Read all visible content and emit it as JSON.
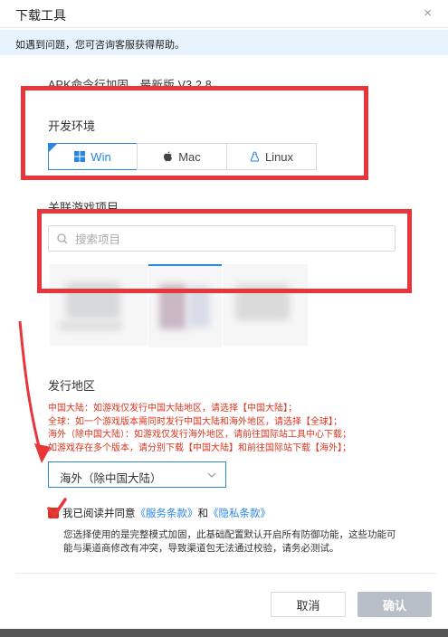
{
  "dialog": {
    "title": "下载工具",
    "close_glyph": "×",
    "notice": "如遇到问题，您可咨询客服获得帮助。",
    "product_line": "APK命令行加固　最新版 V3.2.8"
  },
  "env": {
    "label": "开发环境",
    "options": [
      "Win",
      "Mac",
      "Linux"
    ],
    "selected": "Win"
  },
  "projects": {
    "label": "关联游戏项目",
    "search_placeholder": "搜索项目"
  },
  "region": {
    "label": "发行地区",
    "lines": [
      "中国大陆：如游戏仅发行中国大陆地区，请选择【中国大陆】；",
      "全球：如一个游戏版本需同时发行中国大陆和海外地区，请选择【全球】；",
      "海外（除中国大陆）：如游戏仅发行海外地区，请前往国际站工具中心下载；",
      "如游戏存在多个版本，请分别下载【中国大陆】和前往国际站下载【海外】；"
    ],
    "selected": "海外（除中国大陆）"
  },
  "agree": {
    "text": "我已阅读并同意",
    "link1": "《服务条款》",
    "and": "和",
    "link2": "《隐私条款》",
    "checked": true
  },
  "note": "您选择使用的是完整模式加固，此基础配置默认开启所有防御功能，这些功能可能与渠道商修改有冲突，导致渠道包无法通过校验，请务必测试。",
  "buttons": {
    "cancel": "取消",
    "confirm": "确认"
  },
  "colors": {
    "accent": "#2a86e0",
    "warning": "#d9341f",
    "annotation": "#e8363a",
    "disabled": "#b7bec8"
  }
}
